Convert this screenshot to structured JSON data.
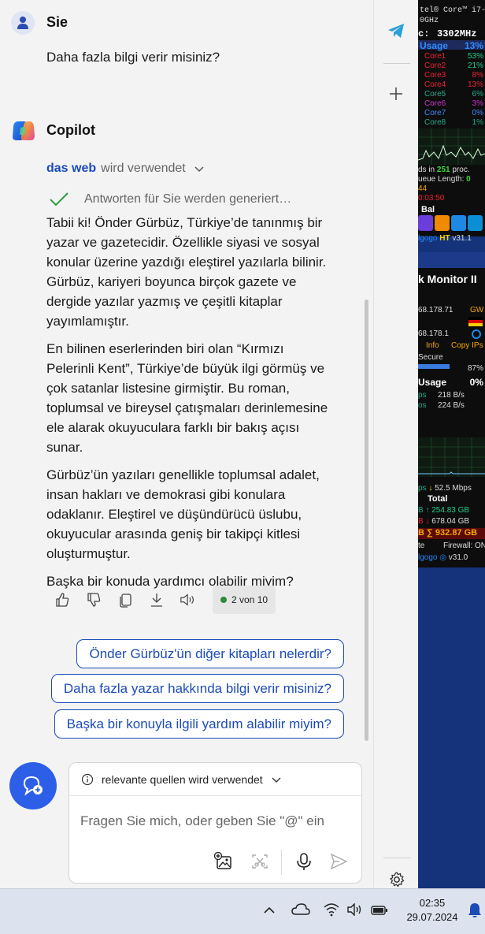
{
  "user": {
    "name": "Sie",
    "message": "Daha fazla bilgi verir misiniz?"
  },
  "copilot": {
    "name": "Copilot",
    "web_source": "das web",
    "web_suffix": "wird verwendet",
    "progress": "Antworten für Sie werden generiert…",
    "paragraphs": [
      "Tabii ki! Önder Gürbüz, Türkiye’de tanınmış bir yazar ve gazetecidir. Özellikle siyasi ve sosyal konular üzerine yazdığı eleştirel yazılarla bilinir. Gürbüz, kariyeri boyunca birçok gazete ve dergide yazılar yazmış ve çeşitli kitaplar yayımlamıştır.",
      "En bilinen eserlerinden biri olan “Kırmızı Pelerinli Kent”, Türkiye’de büyük ilgi görmüş ve çok satanlar listesine girmiştir. Bu roman, toplumsal ve bireysel çatışmaları derinlemesine ele alarak okuyuculara farklı bir bakış açısı sunar.",
      "Gürbüz’ün yazıları genellikle toplumsal adalet, insan hakları ve demokrasi gibi konulara odaklanır. Eleştirel ve düşündürücü üslubu, okuyucular arasında geniş bir takipçi kitlesi oluşturmuştur.",
      "Başka bir konuda yardımcı olabilir miyim?"
    ],
    "counter": "2 von 10"
  },
  "suggestions": [
    "Önder Gürbüz'ün diğer kitapları nelerdir?",
    "Daha fazla yazar hakkında bilgi verir misiniz?",
    "Başka bir konuyla ilgili yardım alabilir miyim?"
  ],
  "input": {
    "sources": "relevante quellen wird verwendet",
    "placeholder": "Fragen Sie mich, oder geben Sie \"@\" ein"
  },
  "taskbar": {
    "time": "02:35",
    "date": "29.07.2024"
  },
  "monitor": {
    "cpu_name": "tel® Core™ i7-",
    "freq_label": "0GHz",
    "clock_label": "c:",
    "clock_value": "3302MHz",
    "usage_label": "Usage",
    "usage_value": "13%",
    "cores": [
      {
        "name": "Core1",
        "value": "53%"
      },
      {
        "name": "Core2",
        "value": "21%"
      },
      {
        "name": "Core3",
        "value": "8%"
      },
      {
        "name": "Core4",
        "value": "13%"
      },
      {
        "name": "Core5",
        "value": "6%"
      },
      {
        "name": "Core6",
        "value": "3%"
      },
      {
        "name": "Core7",
        "value": "0%"
      },
      {
        "name": "Core8",
        "value": "1%"
      }
    ],
    "threads_prefix": "ds in",
    "threads_value": "251",
    "threads_suffix": "proc.",
    "queue_label": "ueue Length:",
    "queue_value": "0",
    "line_44": "44",
    "line_time": "0:03:50",
    "bal": "Bal",
    "brand1": "lgogo",
    "ver1_prefix": "HT",
    "ver1": "v31.1",
    "net_title": "k Monitor II",
    "ip1": "68.178.71",
    "gw": "GW",
    "ip2": "68.178.1",
    "info": "Info",
    "copy_ips": "Copy IPs",
    "secure": "Secure",
    "pct": "87%",
    "usage2": "Usage",
    "usage2_value": "0%",
    "rate1_prefix": "ps",
    "rate1": "218 B/s",
    "rate2_prefix": "os",
    "rate2": "224 B/s",
    "mbps_prefix": "ps",
    "mbps": "52.5 Mbps",
    "total": "Total",
    "total_up": "254.83 GB",
    "total_down": "678.04 GB",
    "total_sum": "932.87 GB",
    "firewall_prefix": "te",
    "firewall": "Firewall: ON",
    "brand2": "lgogo",
    "ver2": "v31.0"
  }
}
